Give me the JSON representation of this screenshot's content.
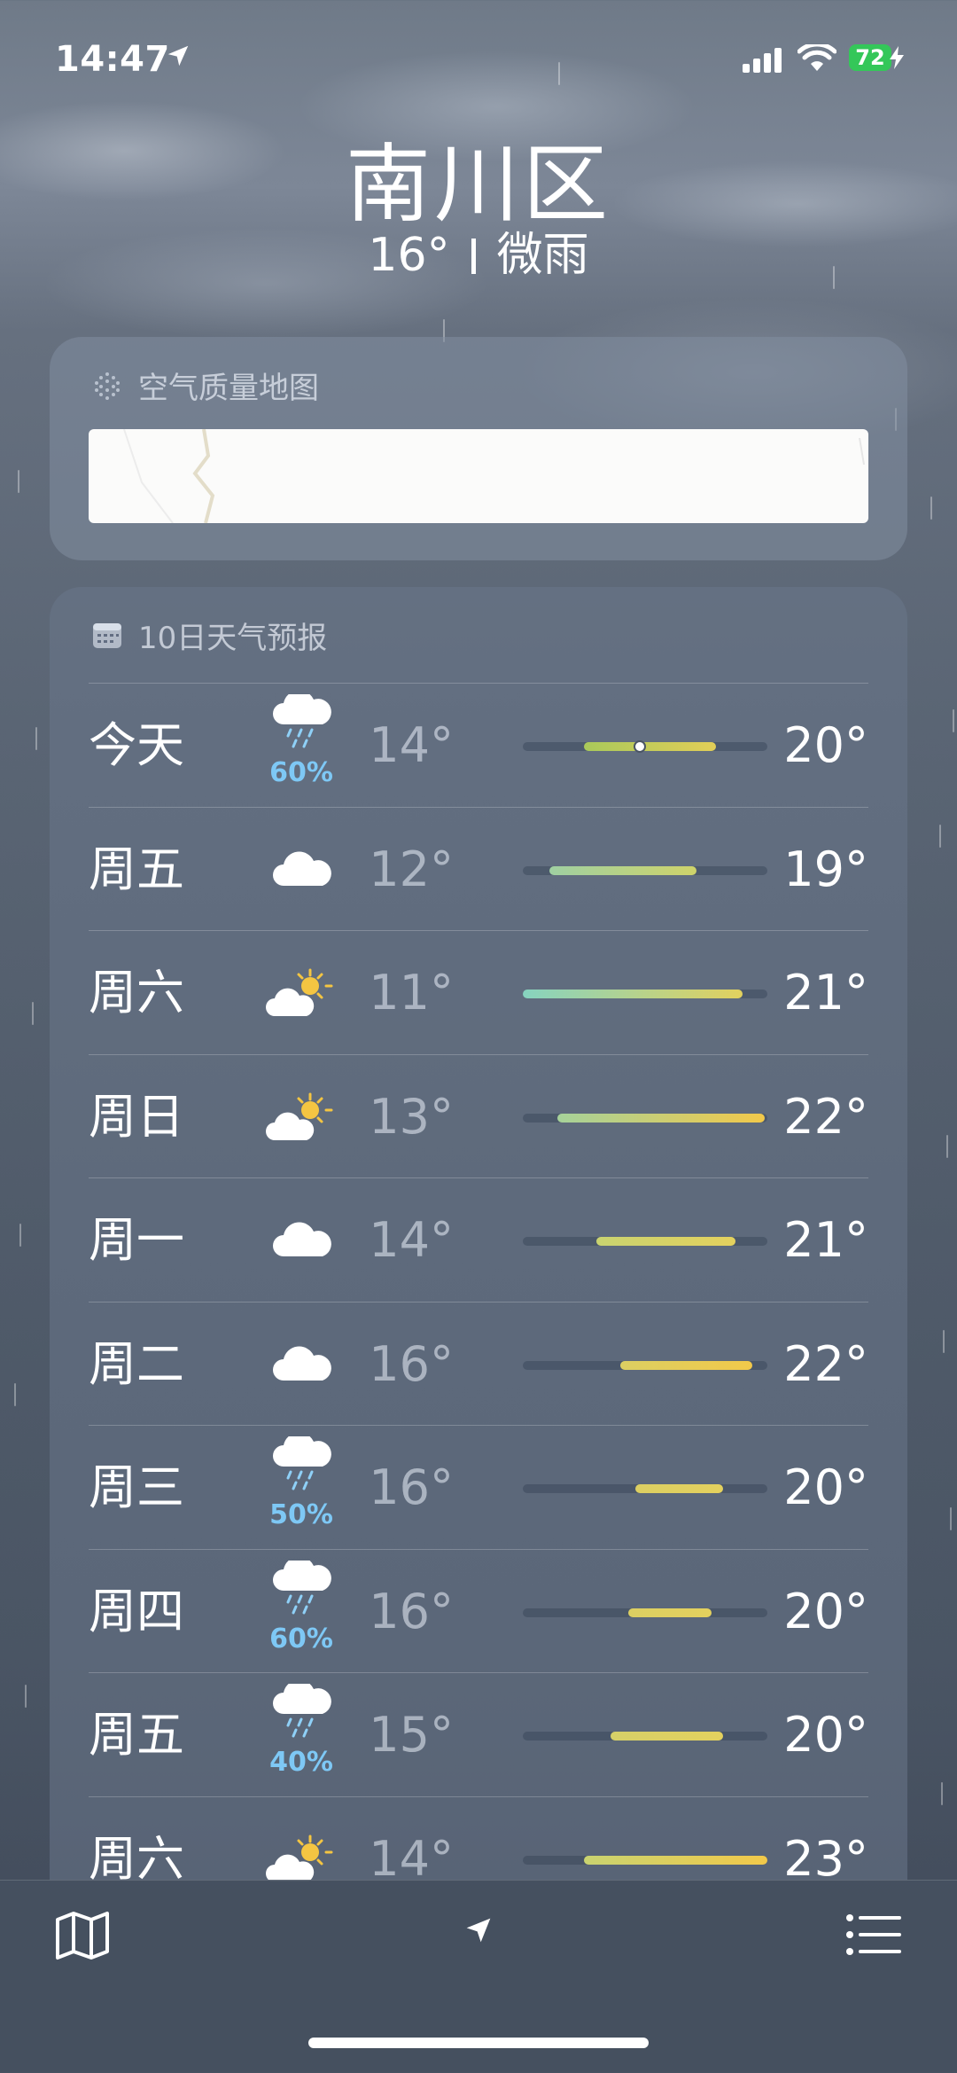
{
  "status_bar": {
    "time": "14:47",
    "battery": "72"
  },
  "header": {
    "city": "南川区",
    "temperature": "16°",
    "condition": "微雨"
  },
  "air_quality": {
    "title": "空气质量地图"
  },
  "forecast": {
    "title": "10日天气预报",
    "days": [
      {
        "day": "今天",
        "icon": "cloud-rain-icon",
        "precip": "60%",
        "low": "14°",
        "high": "20°",
        "bar_start": 0.25,
        "bar_end": 0.79,
        "current": 0.48,
        "bar_color_from": "#a9c95a",
        "bar_color_to": "#e2ce58"
      },
      {
        "day": "周五",
        "icon": "cloud-icon",
        "precip": "",
        "low": "12°",
        "high": "19°",
        "bar_start": 0.11,
        "bar_end": 0.71,
        "bar_color_from": "#9fd0a2",
        "bar_color_to": "#cfd36a"
      },
      {
        "day": "周六",
        "icon": "sun-cloud-icon",
        "precip": "",
        "low": "11°",
        "high": "21°",
        "bar_start": 0.0,
        "bar_end": 0.9,
        "bar_color_from": "#86d3c0",
        "bar_color_to": "#e2d15e"
      },
      {
        "day": "周日",
        "icon": "sun-cloud-icon",
        "precip": "",
        "low": "13°",
        "high": "22°",
        "bar_start": 0.14,
        "bar_end": 0.99,
        "bar_color_from": "#a6d29a",
        "bar_color_to": "#f2c94a"
      },
      {
        "day": "周一",
        "icon": "cloud-icon",
        "precip": "",
        "low": "14°",
        "high": "21°",
        "bar_start": 0.3,
        "bar_end": 0.87,
        "bar_color_from": "#c9d370",
        "bar_color_to": "#e4d15e"
      },
      {
        "day": "周二",
        "icon": "cloud-icon",
        "precip": "",
        "low": "16°",
        "high": "22°",
        "bar_start": 0.4,
        "bar_end": 0.94,
        "bar_color_from": "#dccf62",
        "bar_color_to": "#f2c94a"
      },
      {
        "day": "周三",
        "icon": "cloud-rain-icon",
        "precip": "50%",
        "low": "16°",
        "high": "20°",
        "bar_start": 0.46,
        "bar_end": 0.82,
        "bar_color_from": "#dccf62",
        "bar_color_to": "#e4d15e"
      },
      {
        "day": "周四",
        "icon": "cloud-rain-icon",
        "precip": "60%",
        "low": "16°",
        "high": "20°",
        "bar_start": 0.43,
        "bar_end": 0.77,
        "bar_color_from": "#dccf62",
        "bar_color_to": "#e4d15e"
      },
      {
        "day": "周五",
        "icon": "cloud-rain-icon",
        "precip": "40%",
        "low": "15°",
        "high": "20°",
        "bar_start": 0.36,
        "bar_end": 0.82,
        "bar_color_from": "#d6d068",
        "bar_color_to": "#e4d15e"
      },
      {
        "day": "周六",
        "icon": "sun-cloud-icon",
        "precip": "",
        "low": "14°",
        "high": "23°",
        "bar_start": 0.25,
        "bar_end": 1.0,
        "bar_color_from": "#c9d370",
        "bar_color_to": "#f2c94a"
      }
    ]
  }
}
